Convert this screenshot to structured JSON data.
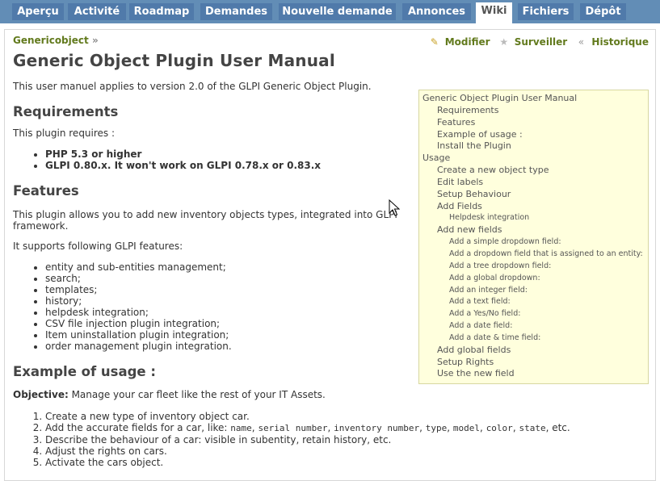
{
  "tabs": [
    {
      "label": "Aperçu",
      "selected": false
    },
    {
      "label": "Activité",
      "selected": false
    },
    {
      "label": "Roadmap",
      "selected": false
    },
    {
      "label": "Demandes",
      "selected": false
    },
    {
      "label": "Nouvelle demande",
      "selected": false
    },
    {
      "label": "Annonces",
      "selected": false
    },
    {
      "label": "Wiki",
      "selected": true
    },
    {
      "label": "Fichiers",
      "selected": false
    },
    {
      "label": "Dépôt",
      "selected": false
    }
  ],
  "breadcrumb": {
    "link": "Genericobject",
    "separator": "»"
  },
  "actions": {
    "edit": "Modifier",
    "watch": "Surveiller",
    "history": "Historique"
  },
  "page_title": "Generic Object Plugin User Manual",
  "intro": "This user manuel applies to version 2.0 of the GLPI Generic Object Plugin.",
  "requirements": {
    "heading": "Requirements",
    "text": "This plugin requires :",
    "items": [
      "PHP 5.3 or higher",
      "GLPI 0.80.x. It won't work on GLPI 0.78.x or 0.83.x"
    ]
  },
  "features": {
    "heading": "Features",
    "text": "This plugin allows you to add new inventory objects types, integrated into GLPI framework.",
    "text2": "It supports following GLPI features:",
    "items": [
      "entity and sub-entities management;",
      "search;",
      "templates;",
      "history;",
      "helpdesk integration;",
      "CSV file injection plugin integration;",
      "Item uninstallation plugin integration;",
      "order management plugin integration."
    ]
  },
  "example": {
    "heading": "Example of usage :",
    "objective_label": "Objective:",
    "objective_text": " Manage your car fleet like the rest of your IT Assets.",
    "step1": "Create a new type of inventory object car.",
    "step2_prefix": "Add the accurate fields for a car, like: ",
    "step2_codes": [
      "name",
      "serial number",
      "inventory number",
      "type",
      "model",
      "color",
      "state"
    ],
    "step2_suffix": ", etc.",
    "step3": "Describe the behaviour of a car: visible in subentity, retain history, etc.",
    "step4": "Adjust the rights on cars.",
    "step5": "Activate the cars object."
  },
  "toc": [
    {
      "label": "Generic Object Plugin User Manual",
      "level": 1
    },
    {
      "label": "Requirements",
      "level": 2
    },
    {
      "label": "Features",
      "level": 2
    },
    {
      "label": "Example of usage :",
      "level": 2
    },
    {
      "label": "Install the Plugin",
      "level": 2
    },
    {
      "label": "Usage",
      "level": 1
    },
    {
      "label": "Create a new object type",
      "level": 2
    },
    {
      "label": "Edit labels",
      "level": 2
    },
    {
      "label": "Setup Behaviour",
      "level": 2
    },
    {
      "label": "Add Fields",
      "level": 2
    },
    {
      "label": "Helpdesk integration",
      "level": 3
    },
    {
      "label": "Add new fields",
      "level": 2
    },
    {
      "label": "Add a simple dropdown field:",
      "level": 3
    },
    {
      "label": "Add a dropdown field that is assigned to an entity:",
      "level": 3
    },
    {
      "label": "Add a tree dropdown field:",
      "level": 3
    },
    {
      "label": "Add a global dropdown:",
      "level": 3
    },
    {
      "label": "Add an integer field:",
      "level": 3
    },
    {
      "label": "Add a text field:",
      "level": 3
    },
    {
      "label": "Add a Yes/No field:",
      "level": 3
    },
    {
      "label": "Add a date field:",
      "level": 3
    },
    {
      "label": "Add a date & time field:",
      "level": 3
    },
    {
      "label": "Add global fields",
      "level": 2
    },
    {
      "label": "Setup Rights",
      "level": 2
    },
    {
      "label": "Use the new field",
      "level": 2
    }
  ]
}
